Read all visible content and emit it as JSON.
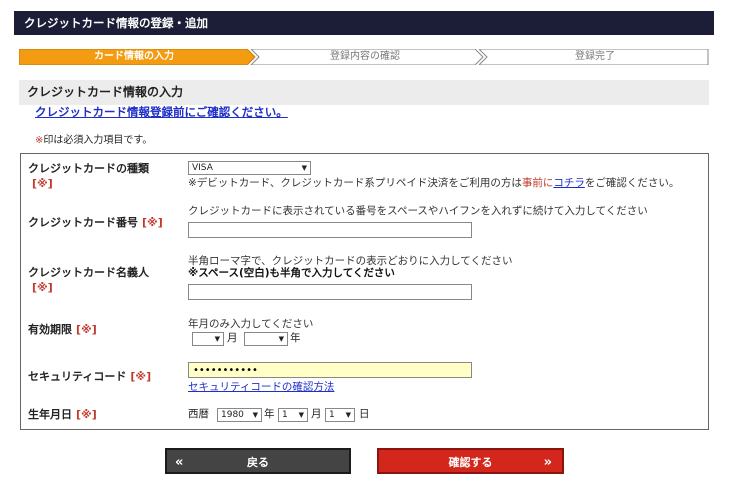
{
  "header": {
    "title": "クレジットカード情報の登録・追加"
  },
  "steps": [
    {
      "label": "カード情報の入力",
      "active": true
    },
    {
      "label": "登録内容の確認",
      "active": false
    },
    {
      "label": "登録完了",
      "active": false
    }
  ],
  "section": {
    "title": "クレジットカード情報の入力",
    "notice_link": "クレジットカード情報登録前にご確認ください。",
    "required_note_mark": "※",
    "required_note_text": "印は必須入力項目です。"
  },
  "required_mark": "[※]",
  "form": {
    "card_type": {
      "label": "クレジットカードの種類",
      "value": "VISA",
      "hint_before": "※デビットカード、クレジットカード系プリペイド決済をご利用の方は",
      "hint_red": "事前に",
      "hint_link": "コチラ",
      "hint_after": "をご確認ください。"
    },
    "card_number": {
      "label": "クレジットカード番号",
      "hint": "クレジットカードに表示されている番号をスペースやハイフンを入れずに続けて入力してください",
      "value": ""
    },
    "card_holder": {
      "label": "クレジットカード名義人",
      "hint": "半角ローマ字で、クレジットカードの表示どおりに入力してください",
      "hint_bold": "※スペース(空白)も半角で入力してください",
      "value": ""
    },
    "expiry": {
      "label": "有効期限",
      "hint": "年月のみ入力してください",
      "month_value": "",
      "month_unit": "月",
      "year_value": "",
      "year_unit": "年"
    },
    "security_code": {
      "label": "セキュリティコード",
      "value": "•••••••••••",
      "help_link": "セキュリティコードの確認方法"
    },
    "birthdate": {
      "label": "生年月日",
      "era": "西暦",
      "year": "1980",
      "year_unit": "年",
      "month": "1",
      "month_unit": "月",
      "day": "1",
      "day_unit": "日"
    }
  },
  "buttons": {
    "back_label": "戻る",
    "back_chevron": "«",
    "confirm_label": "確認する",
    "confirm_chevron": "»"
  },
  "colors": {
    "header_bg": "#1c1d36",
    "step_active": "#f39c12",
    "required": "#c0392b",
    "link": "#1e2ec8",
    "confirm_button": "#d3271d",
    "back_button": "#444444",
    "security_field_bg": "#ffffc6"
  }
}
